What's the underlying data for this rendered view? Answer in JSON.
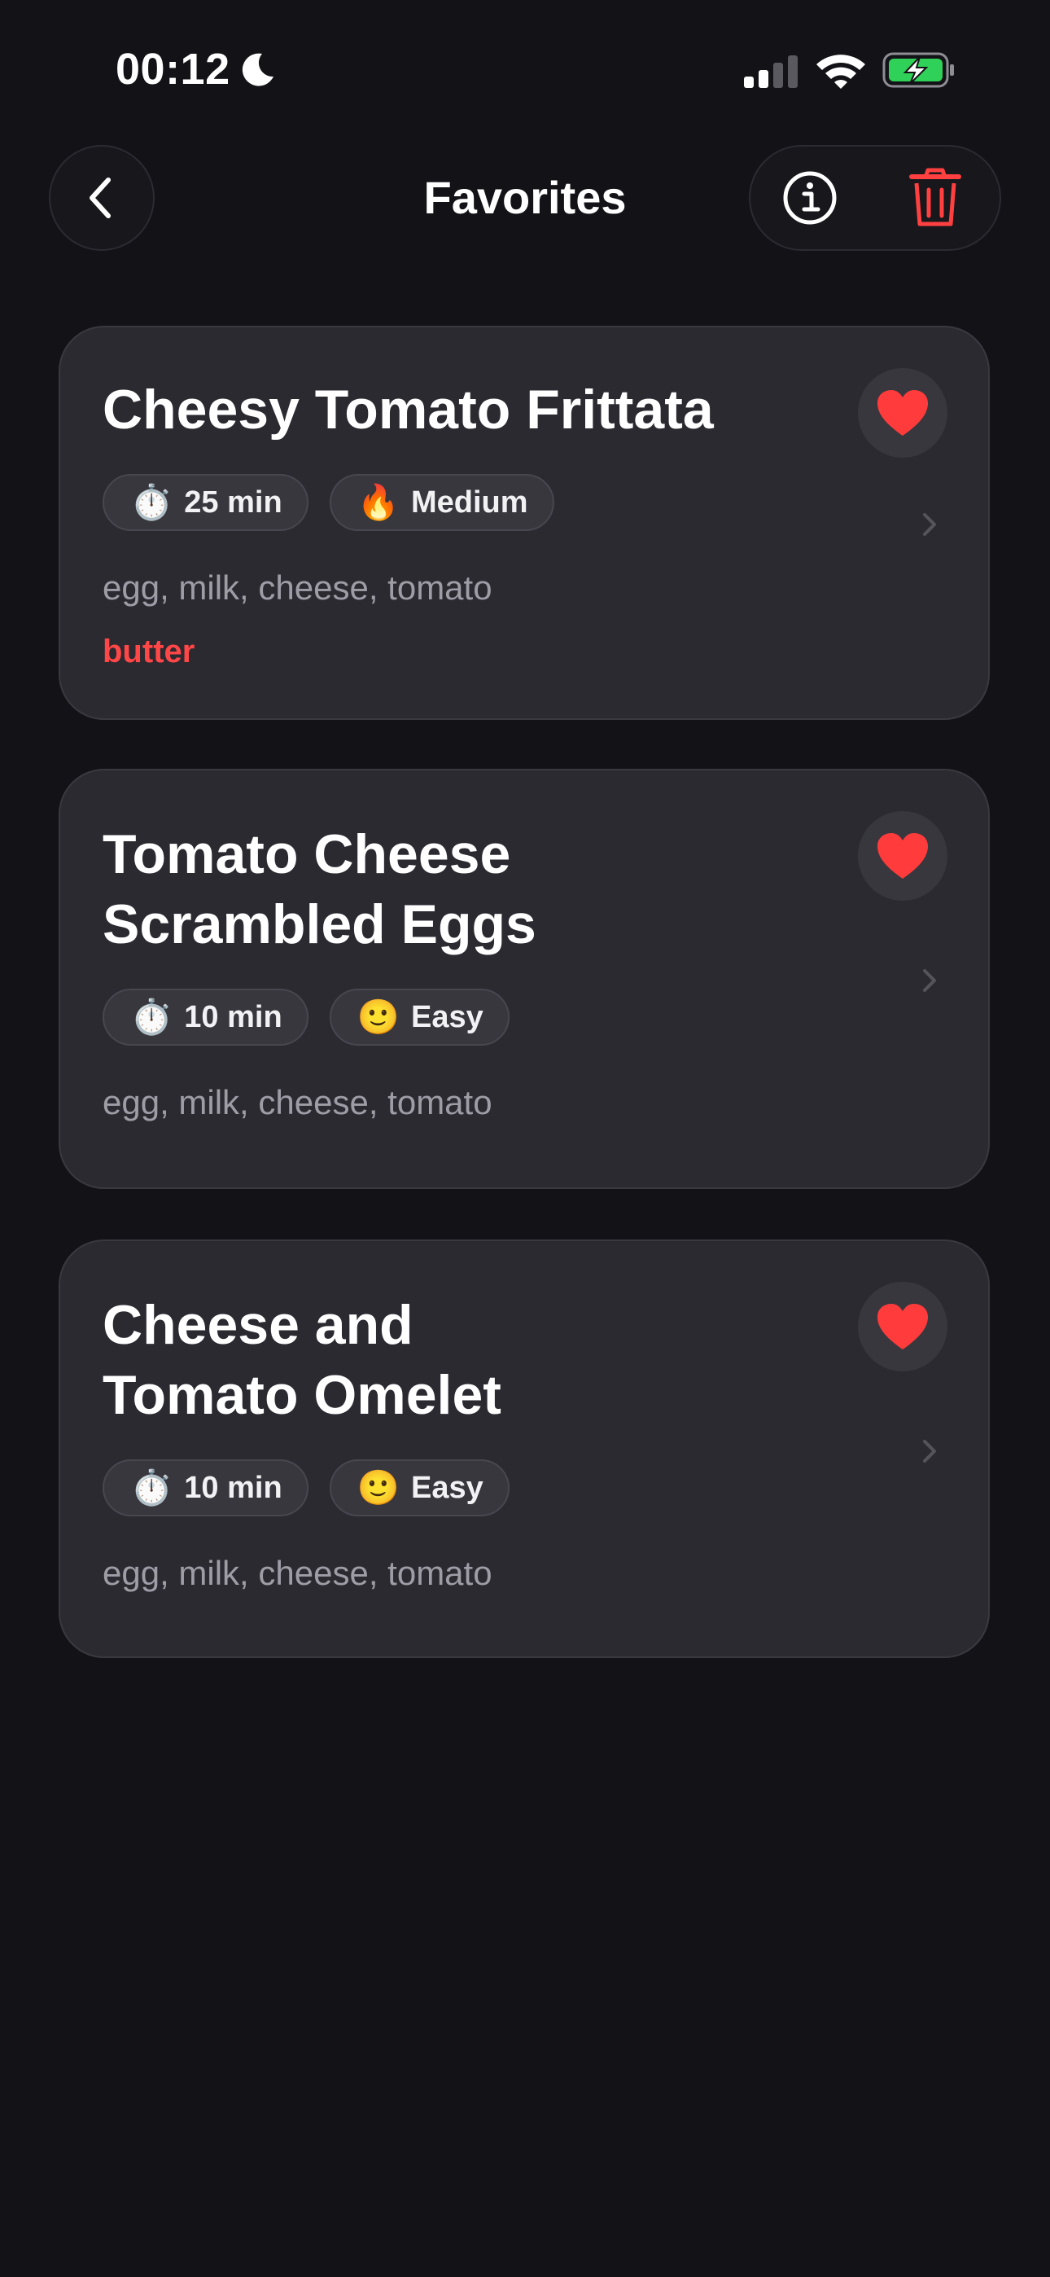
{
  "status": {
    "time": "00:12",
    "accent_battery": "#30d158"
  },
  "nav": {
    "title": "Favorites",
    "icons": {
      "back": "chevron-left-icon",
      "info": "info-circle-icon",
      "trash": "trash-icon"
    },
    "trash_color": "#ff4040"
  },
  "recipes": [
    {
      "title": "Cheesy Tomato Frittata",
      "time": "25 min",
      "time_icon": "⏱️",
      "difficulty": "Medium",
      "difficulty_icon": "🔥",
      "ingredients": "egg, milk, cheese, tomato",
      "missing": "butter",
      "favorite": true
    },
    {
      "title": "Tomato Cheese Scrambled Eggs",
      "title_lines": [
        "Tomato Cheese",
        "Scrambled Eggs"
      ],
      "time": "10 min",
      "time_icon": "⏱️",
      "difficulty": "Easy",
      "difficulty_icon": "🙂",
      "ingredients": "egg, milk, cheese, tomato",
      "favorite": true
    },
    {
      "title": "Cheese and Tomato Omelet",
      "title_lines": [
        "Cheese and",
        "Tomato Omelet"
      ],
      "time": "10 min",
      "time_icon": "⏱️",
      "difficulty": "Easy",
      "difficulty_icon": "🙂",
      "ingredients": "egg, milk, cheese, tomato",
      "favorite": true
    }
  ],
  "colors": {
    "background": "#131217",
    "card": "#2b2a31",
    "heart": "#ff3b3b",
    "missing": "#ff4747"
  }
}
